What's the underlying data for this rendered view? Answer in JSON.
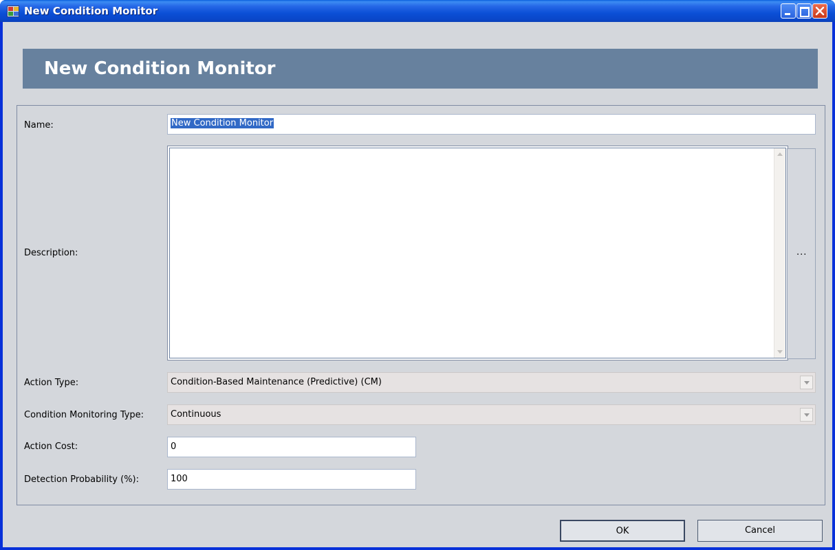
{
  "window": {
    "title": "New Condition Monitor"
  },
  "banner": {
    "title": "New Condition Monitor"
  },
  "form": {
    "name_label": "Name:",
    "name_value": "New Condition Monitor",
    "description_label": "Description:",
    "description_value": "",
    "ellipsis_label": "...",
    "action_type_label": "Action Type:",
    "action_type_value": "Condition-Based Maintenance (Predictive) (CM)",
    "cm_type_label": "Condition Monitoring Type:",
    "cm_type_value": "Continuous",
    "action_cost_label": "Action Cost:",
    "action_cost_value": "0",
    "detection_label": "Detection Probability (%):",
    "detection_value": "100"
  },
  "buttons": {
    "ok": "OK",
    "cancel": "Cancel"
  },
  "colors": {
    "banner": "#67819e",
    "client": "#d4d7dc",
    "selection": "#3169c6"
  }
}
